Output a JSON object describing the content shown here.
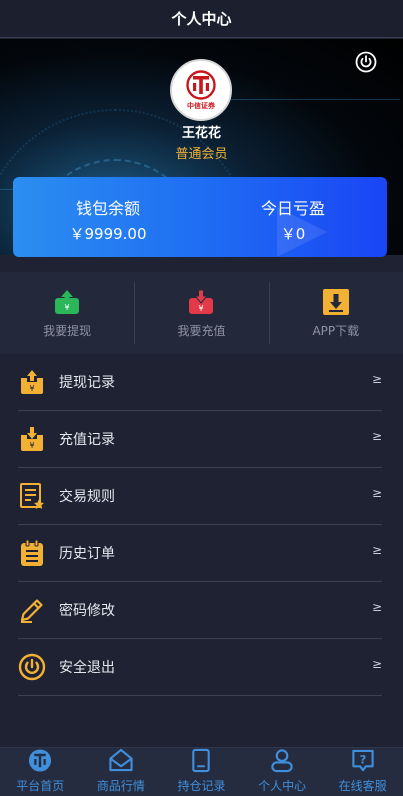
{
  "header": {
    "title": "个人中心"
  },
  "profile": {
    "logo_text": "中信证券",
    "name": "王花花",
    "level": "普通会员"
  },
  "wallet": {
    "balance_label": "钱包余额",
    "balance_value": "￥9999.00",
    "pnl_label": "今日亏盈",
    "pnl_value": "￥0"
  },
  "actions": [
    {
      "label": "我要提现",
      "icon": "withdraw-icon",
      "color": "#2bb65a"
    },
    {
      "label": "我要充值",
      "icon": "deposit-icon",
      "color": "#e33a4a"
    },
    {
      "label": "APP下载",
      "icon": "download-icon",
      "color": "#f2b134"
    }
  ],
  "menu": [
    {
      "label": "提现记录",
      "icon": "withdraw-record-icon",
      "arrow": "≥"
    },
    {
      "label": "充值记录",
      "icon": "deposit-record-icon",
      "arrow": "≥"
    },
    {
      "label": "交易规则",
      "icon": "rules-document-icon",
      "arrow": "≥"
    },
    {
      "label": "历史订单",
      "icon": "order-clipboard-icon",
      "arrow": "≥"
    },
    {
      "label": "密码修改",
      "icon": "pencil-icon",
      "arrow": "≥"
    },
    {
      "label": "安全退出",
      "icon": "power-icon",
      "arrow": "≥"
    }
  ],
  "tabbar": [
    {
      "label": "平台首页",
      "icon": "home-logo-icon"
    },
    {
      "label": "商品行情",
      "icon": "envelope-icon"
    },
    {
      "label": "持仓记录",
      "icon": "document-icon"
    },
    {
      "label": "个人中心",
      "icon": "user-icon"
    },
    {
      "label": "在线客服",
      "icon": "help-icon"
    }
  ],
  "colors": {
    "accent": "#f2b134",
    "tab_text": "#3f8fdc",
    "card_start": "#2b8ef0",
    "card_end": "#1a45f5"
  }
}
